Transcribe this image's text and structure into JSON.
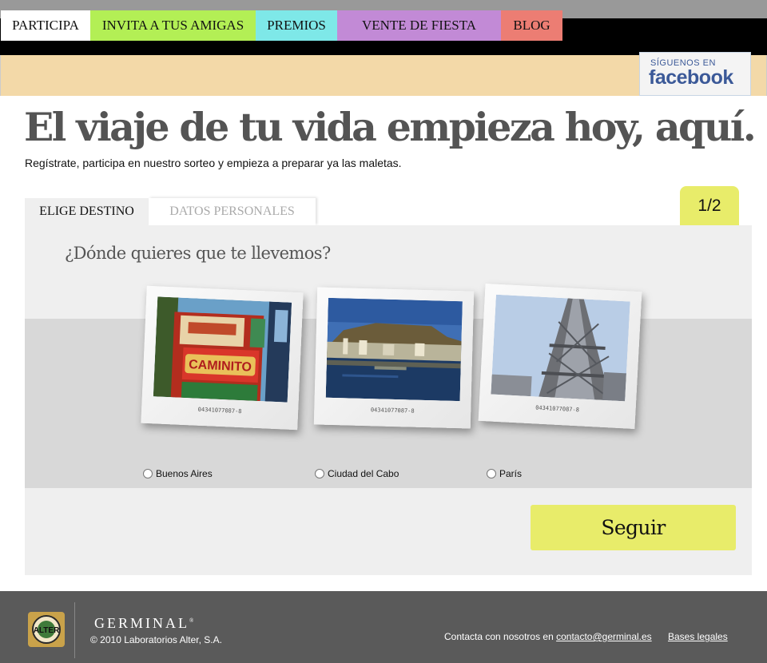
{
  "brand": {
    "name": "GERMINAL",
    "reg": "®"
  },
  "nav": {
    "tabs": [
      {
        "label": "PARTICIPA",
        "color": "#ffffff"
      },
      {
        "label": "INVITA A TUS AMIGAS",
        "color": "#b3ef55"
      },
      {
        "label": "PREMIOS",
        "color": "#7ee8e8"
      },
      {
        "label": "VENTE DE FIESTA",
        "color": "#c28ad6"
      },
      {
        "label": "BLOG",
        "color": "#ec7d73"
      }
    ],
    "facebook": {
      "small": "SÍGUENOS EN",
      "big": "facebook"
    }
  },
  "hero": {
    "headline": "El viaje de tu vida empieza hoy, aquí.",
    "subheadline": "Regístrate, participa en nuestro sorteo y empieza a preparar ya las maletas."
  },
  "steps": {
    "tabs": [
      "ELIGE DESTINO",
      "DATOS PERSONALES"
    ],
    "counter": "1/2",
    "accent": "#e8ec6a"
  },
  "form": {
    "question": "¿Dónde quieres que te llevemos?",
    "destinations": [
      {
        "label": "Buenos Aires",
        "serial": "04341077087-8",
        "selected": false
      },
      {
        "label": "Ciudad del Cabo",
        "serial": "04341077087-8",
        "selected": false
      },
      {
        "label": "París",
        "serial": "04341077087-8",
        "selected": false
      }
    ],
    "submit_label": "Seguir"
  },
  "footer": {
    "brand": "GERMINAL",
    "reg": "®",
    "copyright": "© 2010 Laboratorios Alter, S.A.",
    "alter_logo_text": "ALTER",
    "contact_prefix": "Contacta con nosotros en",
    "contact_email": "contacto@germinal.es",
    "legal_label": "Bases legales"
  }
}
